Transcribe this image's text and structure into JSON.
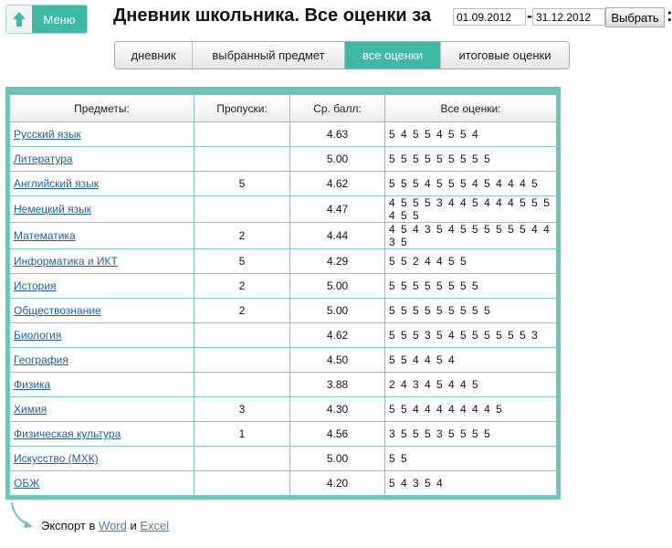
{
  "header": {
    "menu_label": "Меню",
    "title": "Дневник школьника. Все оценки за",
    "date_from": "01.09.2012",
    "date_to": "31.12.2012",
    "dash": "-",
    "select_button": "Выбрать",
    "colon": ":"
  },
  "tabs": [
    {
      "label": "дневник",
      "active": false
    },
    {
      "label": "выбранный предмет",
      "active": false
    },
    {
      "label": "все оценки",
      "active": true
    },
    {
      "label": "итоговые оценки",
      "active": false
    }
  ],
  "table": {
    "columns": [
      "Предметы:",
      "Пропуски:",
      "Ср. балл:",
      "Все оценки:"
    ],
    "rows": [
      {
        "subject": "Русский язык",
        "absences": "",
        "avg": "4.63",
        "grades": "5 4 5 5 4 5 5 4"
      },
      {
        "subject": "Литература",
        "absences": "",
        "avg": "5.00",
        "grades": "5 5 5 5 5 5 5 5 5"
      },
      {
        "subject": "Английский язык",
        "absences": "5",
        "avg": "4.62",
        "grades": "5 5 5 4 5 5 5 4 5 4 4 4 5"
      },
      {
        "subject": "Немецкий язык",
        "absences": "",
        "avg": "4.47",
        "grades": "4 5 5 5 3 4 4 5 4 4 4 5 5 5 4 5 5"
      },
      {
        "subject": "Математика",
        "absences": "2",
        "avg": "4.44",
        "grades": "4 5 4 3 5 4 5 5 5 5 5 5 4 4 3 5"
      },
      {
        "subject": "Информатика и ИКТ",
        "absences": "5",
        "avg": "4.29",
        "grades": "5 5 2 4 4 5 5"
      },
      {
        "subject": "История",
        "absences": "2",
        "avg": "5.00",
        "grades": "5 5 5 5 5 5 5 5"
      },
      {
        "subject": "Обществознание",
        "absences": "2",
        "avg": "5.00",
        "grades": "5 5 5 5 5 5 5 5 5"
      },
      {
        "subject": "Биология",
        "absences": "",
        "avg": "4.62",
        "grades": "5 5 5 3 5 4 5 5 5 5 5 5 3"
      },
      {
        "subject": "География",
        "absences": "",
        "avg": "4.50",
        "grades": "5 5 4 4 5 4"
      },
      {
        "subject": "Физика",
        "absences": "",
        "avg": "3.88",
        "grades": "2 4 3 4 5 4 4 5"
      },
      {
        "subject": "Химия",
        "absences": "3",
        "avg": "4.30",
        "grades": "5 5 4 4 4 4 4 4 4 5"
      },
      {
        "subject": "Физическая культура",
        "absences": "1",
        "avg": "4.56",
        "grades": "3 5 5 5 3 5 5 5 5"
      },
      {
        "subject": "Искусство (МХК)",
        "absences": "",
        "avg": "5.00",
        "grades": "5 5"
      },
      {
        "subject": "ОБЖ",
        "absences": "",
        "avg": "4.20",
        "grades": "5 4 3 5 4"
      }
    ]
  },
  "export": {
    "prefix": "Экспорт в",
    "word": "Word",
    "and": "и",
    "excel": "Excel"
  },
  "colors": {
    "accent": "#3fb9a3",
    "border": "#6cc4b6",
    "link": "#1f5f9f"
  }
}
